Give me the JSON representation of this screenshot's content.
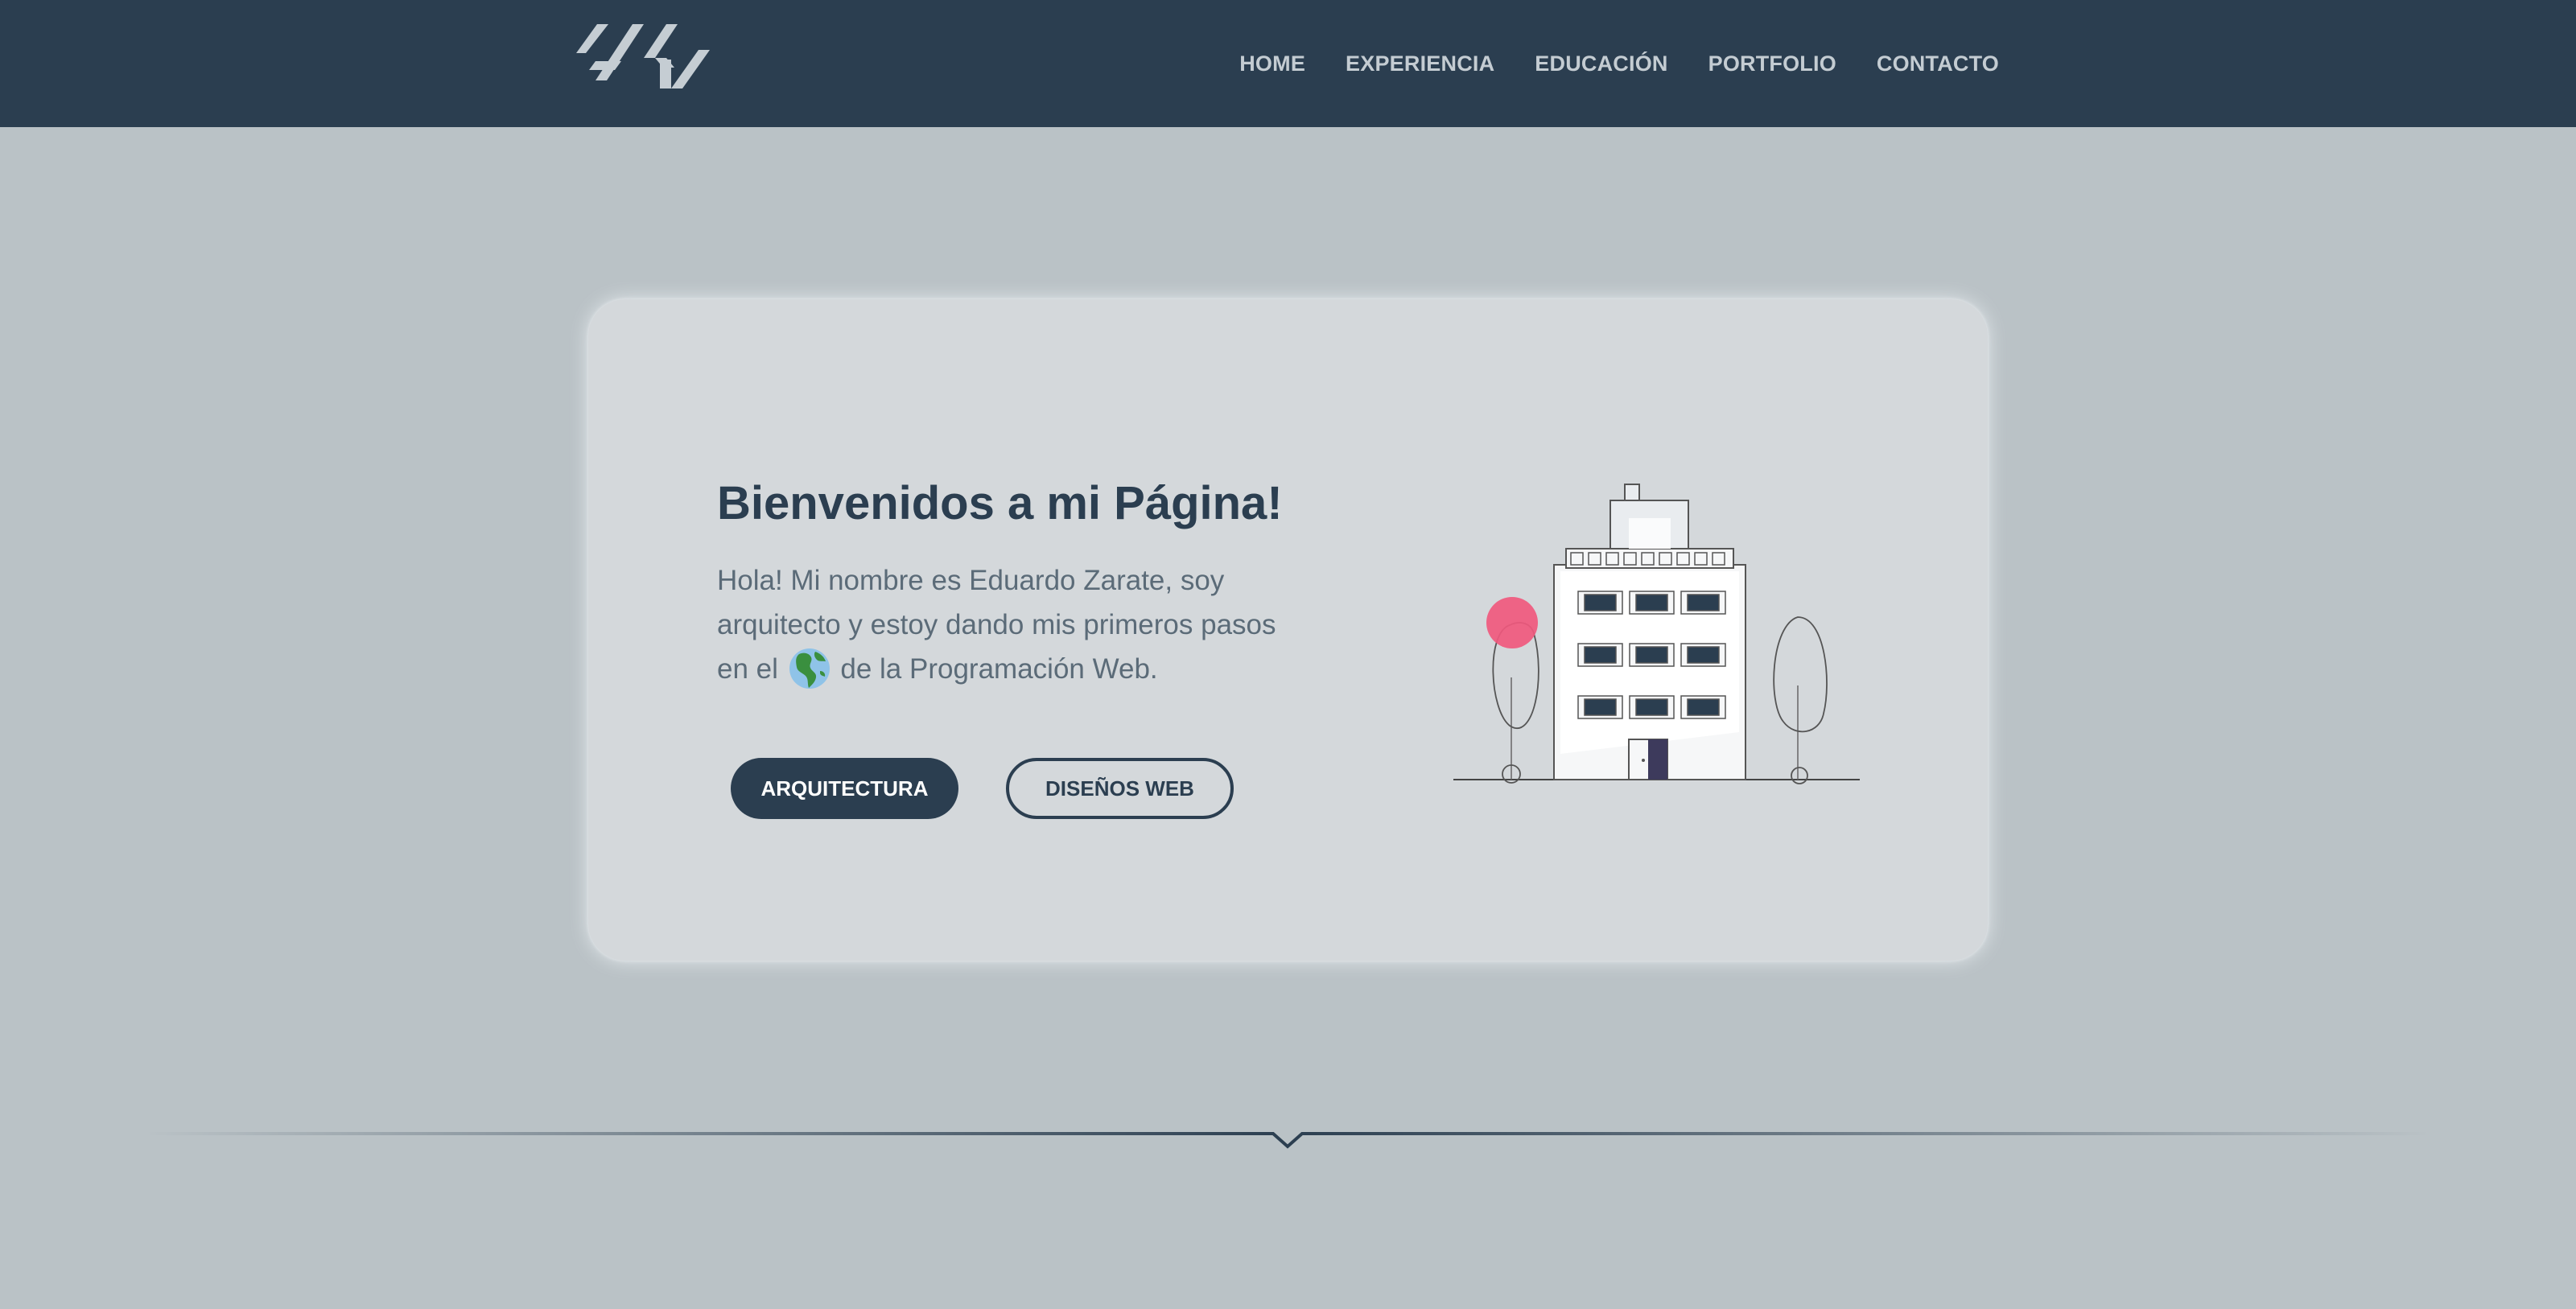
{
  "brand": {
    "logo_icon": "eduardo-zarate-logo-icon"
  },
  "nav": {
    "items": [
      {
        "label": "HOME"
      },
      {
        "label": "EXPERIENCIA"
      },
      {
        "label": "EDUCACIÓN"
      },
      {
        "label": "PORTFOLIO"
      },
      {
        "label": "CONTACTO"
      }
    ]
  },
  "hero": {
    "title": "Bienvenidos a mi Página!",
    "text_before_globe": "Hola! Mi nombre es Eduardo Zarate, soy arquitecto y estoy dando mis primeros pasos en el",
    "globe_icon": "globe-americas-icon",
    "text_after_globe": "de la Programación Web.",
    "buttons": {
      "primary_label": "ARQUITECTURA",
      "secondary_label": "DISEÑOS WEB"
    },
    "illustration_icon": "building-illustration-icon"
  },
  "colors": {
    "navbar": "#2b3e50",
    "page_background": "#bac2c6",
    "card_background": "#d4d8db",
    "accent_dark": "#2b3e50",
    "accent_pink": "#f0597e"
  }
}
